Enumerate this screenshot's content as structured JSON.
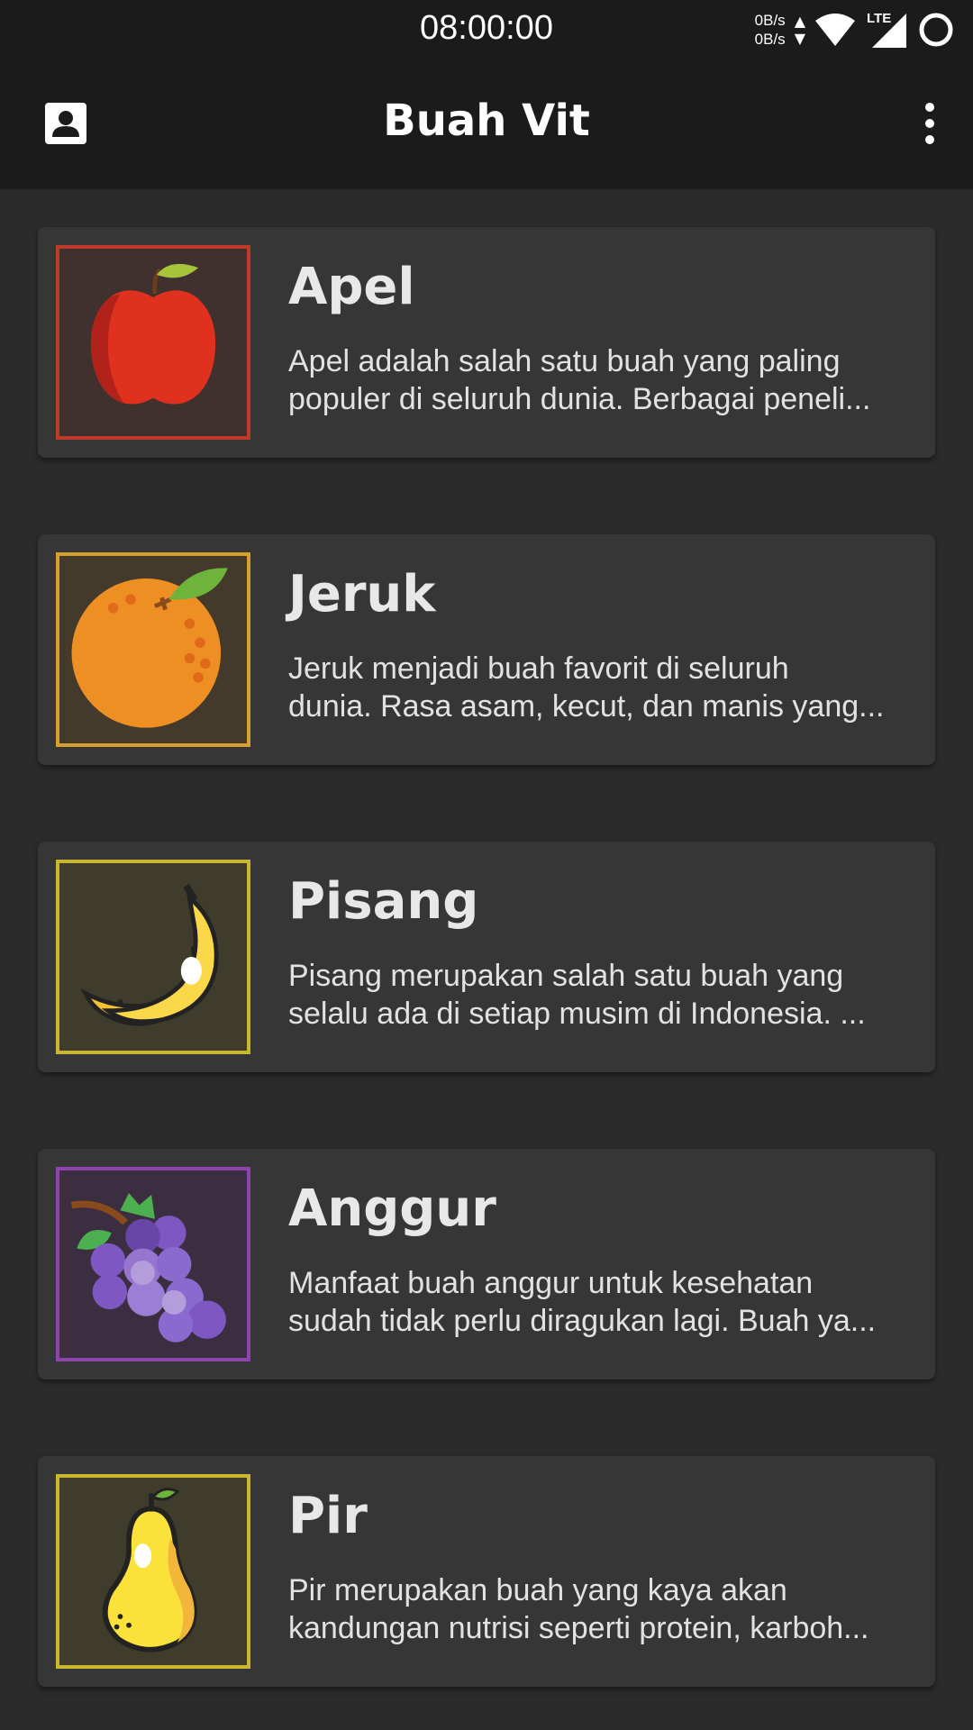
{
  "status_bar": {
    "time": "08:00:00",
    "net_up": "0B/s",
    "net_down": "0B/s",
    "network_type": "LTE",
    "icons": [
      "data-arrows-icon",
      "wifi-icon",
      "lte-signal-icon",
      "circle-icon"
    ]
  },
  "app_bar": {
    "title": "Buah Vit",
    "profile_icon": "account-box-icon",
    "menu_icon": "more-vert-icon"
  },
  "fruits": [
    {
      "name": "Apel",
      "desc_line1": "Apel adalah salah satu buah yang paling",
      "desc_line2": "populer di seluruh dunia. Berbagai peneli...",
      "icon": "apple-icon",
      "border_color": "#c0392b",
      "bg_color": "#40302e"
    },
    {
      "name": "Jeruk",
      "desc_line1": "Jeruk menjadi buah favorit di seluruh",
      "desc_line2": "dunia. Rasa asam, kecut, dan manis yang...",
      "icon": "orange-icon",
      "border_color": "#d4a12e",
      "bg_color": "#433a2c"
    },
    {
      "name": "Pisang",
      "desc_line1": "Pisang merupakan salah satu buah yang",
      "desc_line2": "selalu ada di setiap musim di Indonesia. ...",
      "icon": "banana-icon",
      "border_color": "#c9b631",
      "bg_color": "#403c2c"
    },
    {
      "name": "Anggur",
      "desc_line1": "Manfaat buah anggur untuk kesehatan",
      "desc_line2": "sudah tidak perlu diragukan lagi. Buah ya...",
      "icon": "grapes-icon",
      "border_color": "#8e44ad",
      "bg_color": "#3a2e40"
    },
    {
      "name": "Pir",
      "desc_line1": "Pir merupakan buah yang kaya akan",
      "desc_line2": "kandungan nutrisi seperti protein, karboh...",
      "icon": "pear-icon",
      "border_color": "#c9b631",
      "bg_color": "#403c2c"
    }
  ]
}
